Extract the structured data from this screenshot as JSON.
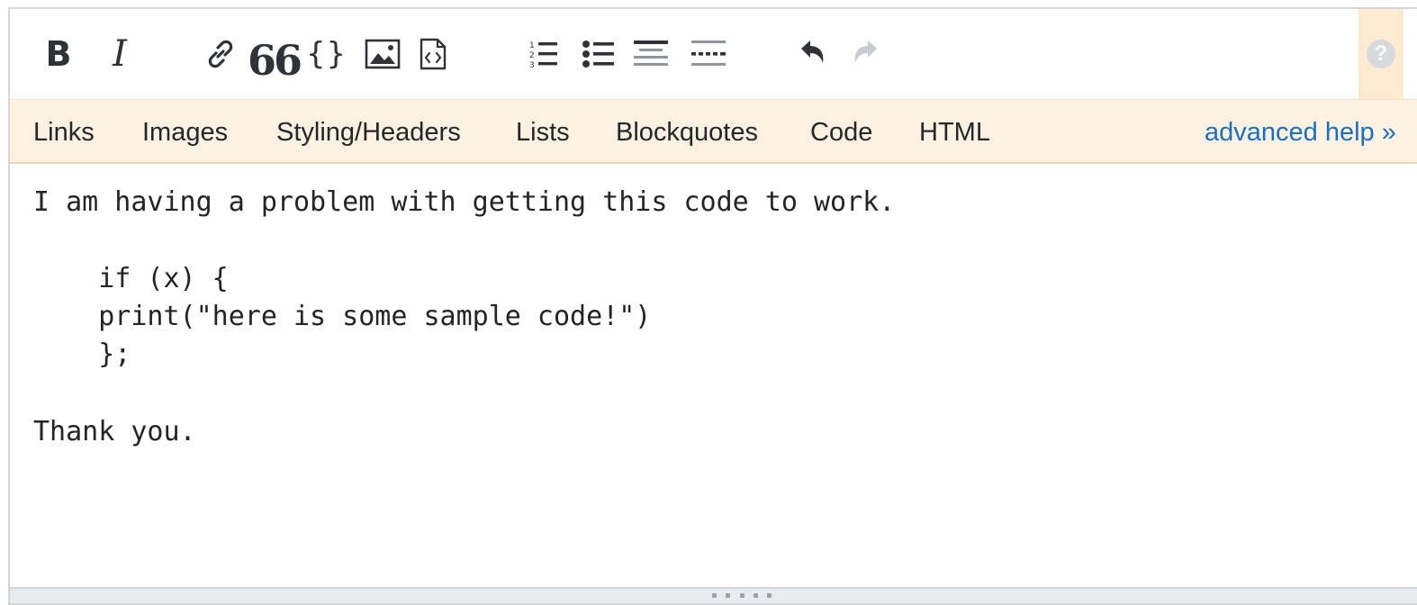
{
  "toolbar": {
    "buttons": [
      {
        "name": "bold",
        "glyph": "B"
      },
      {
        "name": "italic",
        "glyph": "I"
      },
      {
        "name": "link",
        "icon": "link-icon"
      },
      {
        "name": "blockquote",
        "glyph": "66"
      },
      {
        "name": "code",
        "glyph": "{}"
      },
      {
        "name": "image",
        "icon": "image-icon"
      },
      {
        "name": "snippet",
        "icon": "code-snippet-icon"
      },
      {
        "name": "ordered-list",
        "icon": "ordered-list-icon"
      },
      {
        "name": "bulleted-list",
        "icon": "bulleted-list-icon"
      },
      {
        "name": "heading",
        "icon": "heading-icon"
      },
      {
        "name": "horizontal-rule",
        "icon": "horizontal-rule-icon"
      },
      {
        "name": "undo",
        "icon": "undo-icon"
      },
      {
        "name": "redo",
        "icon": "redo-icon",
        "disabled": true
      }
    ],
    "bold_glyph": "B",
    "italic_glyph": "I",
    "quote_glyph": "66",
    "code_glyph": "{}",
    "help_glyph": "?"
  },
  "help_bar": {
    "links": [
      "Links",
      "Images",
      "Styling/Headers",
      "Lists",
      "Blockquotes",
      "Code",
      "HTML"
    ],
    "advanced": "advanced help »"
  },
  "editor": {
    "lines": [
      "I am having a problem with getting this code to work.",
      "",
      "    if (x) {",
      "    print(\"here is some sample code!\")",
      "    };",
      "",
      "Thank you."
    ]
  },
  "colors": {
    "accent_bg": "#fdf2e2",
    "link_blue": "#1a6fc2",
    "icon_dark": "#2f3337",
    "icon_disabled": "#c8ccd0"
  }
}
